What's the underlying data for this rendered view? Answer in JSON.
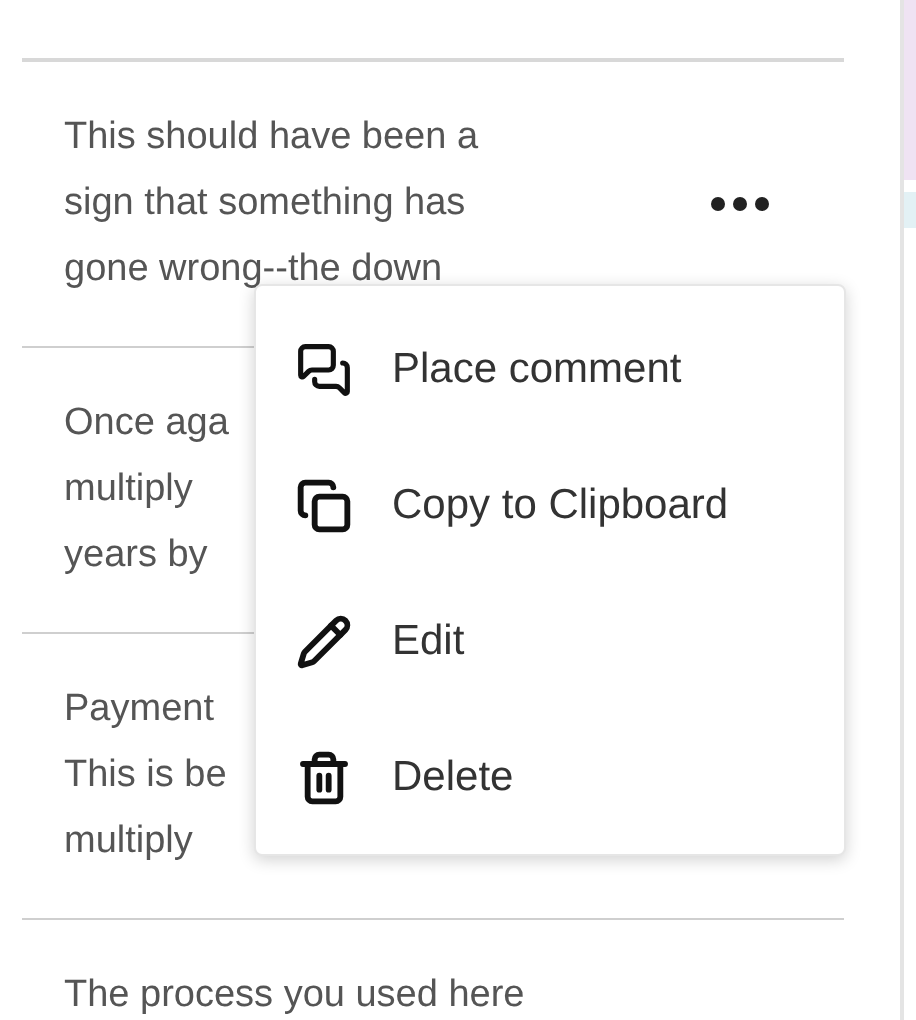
{
  "comments": [
    {
      "lines": [
        "This should have been a",
        "sign that something has",
        "gone wrong--the down"
      ],
      "actions_icon": true
    },
    {
      "lines": [
        "Once aga",
        "multiply",
        "years by"
      ],
      "actions_icon": false
    },
    {
      "lines": [
        "Payment",
        "This is be",
        "multiply"
      ],
      "actions_icon": false
    },
    {
      "lines": [
        "The process you used here"
      ],
      "actions_icon": false
    }
  ],
  "context_menu": {
    "items": [
      {
        "label": "Place comment",
        "kind": "comment"
      },
      {
        "label": "Copy to Clipboard",
        "kind": "copy"
      },
      {
        "label": "Edit",
        "kind": "edit"
      },
      {
        "label": "Delete",
        "kind": "delete"
      }
    ]
  }
}
